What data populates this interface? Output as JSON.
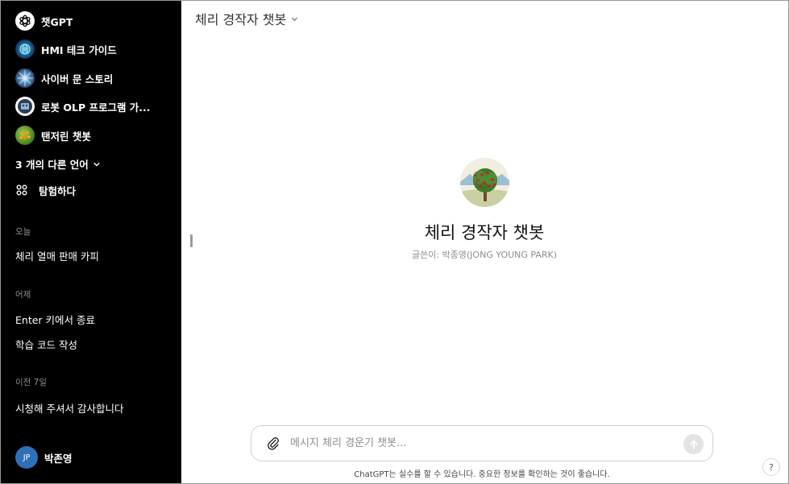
{
  "sidebar": {
    "gpts": [
      {
        "label": "챗GPT",
        "icon": "openai-logo-icon"
      },
      {
        "label": "HMI 테크 가이드",
        "icon": "hmi-globe-avatar-icon"
      },
      {
        "label": "사이버 문 스토리",
        "icon": "cyber-moon-avatar-icon"
      },
      {
        "label": "로봇 OLP 프로그램 가...",
        "icon": "robot-olp-avatar-icon"
      },
      {
        "label": "탠저린 챗봇",
        "icon": "tangerine-avatar-icon"
      }
    ],
    "more_languages": "3 개의 다른 언어",
    "explore": "탐험하다",
    "sections": [
      {
        "label": "오늘",
        "items": [
          "체리 열매 판매 카피"
        ]
      },
      {
        "label": "어제",
        "items": [
          "Enter 키에서 종료",
          "학습 코드 작성"
        ]
      },
      {
        "label": "이전 7일",
        "items": [
          "시청해 주셔서 감사합니다"
        ]
      }
    ],
    "user": {
      "initials": "JP",
      "name": "박존영",
      "avatar_color": "#2f6fb7"
    }
  },
  "header": {
    "title": "체리 경작자 챗봇"
  },
  "hero": {
    "title": "체리 경작자 챗봇",
    "subtitle": "글쓴이: 박종영(JONG YOUNG PARK)"
  },
  "composer": {
    "placeholder": "메시지 체리 경운기 챗봇..."
  },
  "footer": {
    "disclaimer": "ChatGPT는 실수를 할 수 있습니다. 중요한 정보를 확인하는 것이 좋습니다.",
    "help": "?"
  }
}
